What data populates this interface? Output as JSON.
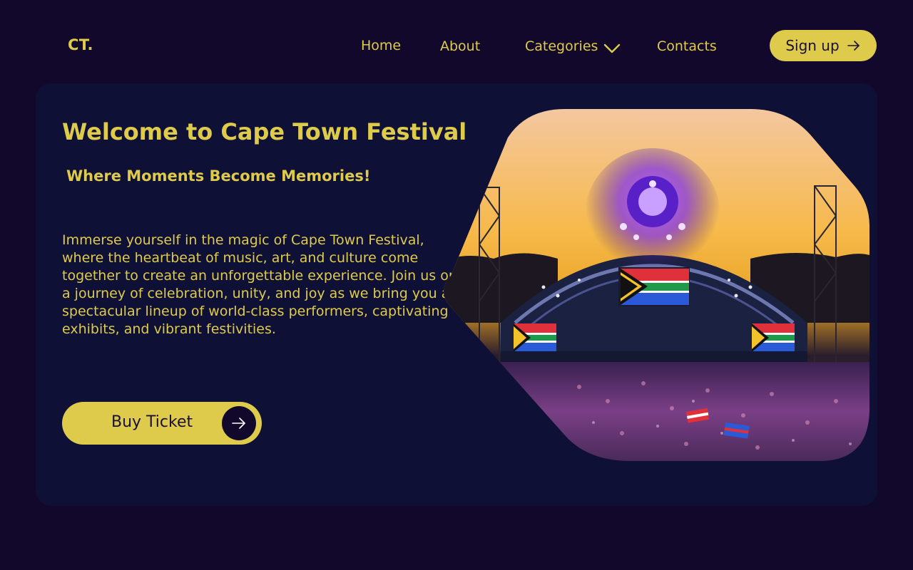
{
  "logo": "CT.",
  "nav": {
    "home": "Home",
    "about": "About",
    "categories": "Categories",
    "contacts": "Contacts"
  },
  "signup_label": "Sign up",
  "hero": {
    "title": "Welcome to Cape Town Festival",
    "subtitle": "Where Moments Become Memories!",
    "description": "Immerse yourself in the magic of Cape Town Festival, where the heartbeat of music, art, and culture come together to create an unforgettable experience. Join us on a journey of celebration, unity, and joy as we bring you a spectacular lineup of world-class performers, captivating exhibits, and vibrant festivities.",
    "cta_label": "Buy Ticket"
  },
  "colors": {
    "background": "#12082c",
    "card": "#0f1035",
    "accent": "#decb4b",
    "dark_text": "#1a1033"
  },
  "icons": {
    "nav_dropdown": "chevron-down-icon",
    "signup": "arrow-right-icon",
    "cta": "arrow-right-icon"
  }
}
